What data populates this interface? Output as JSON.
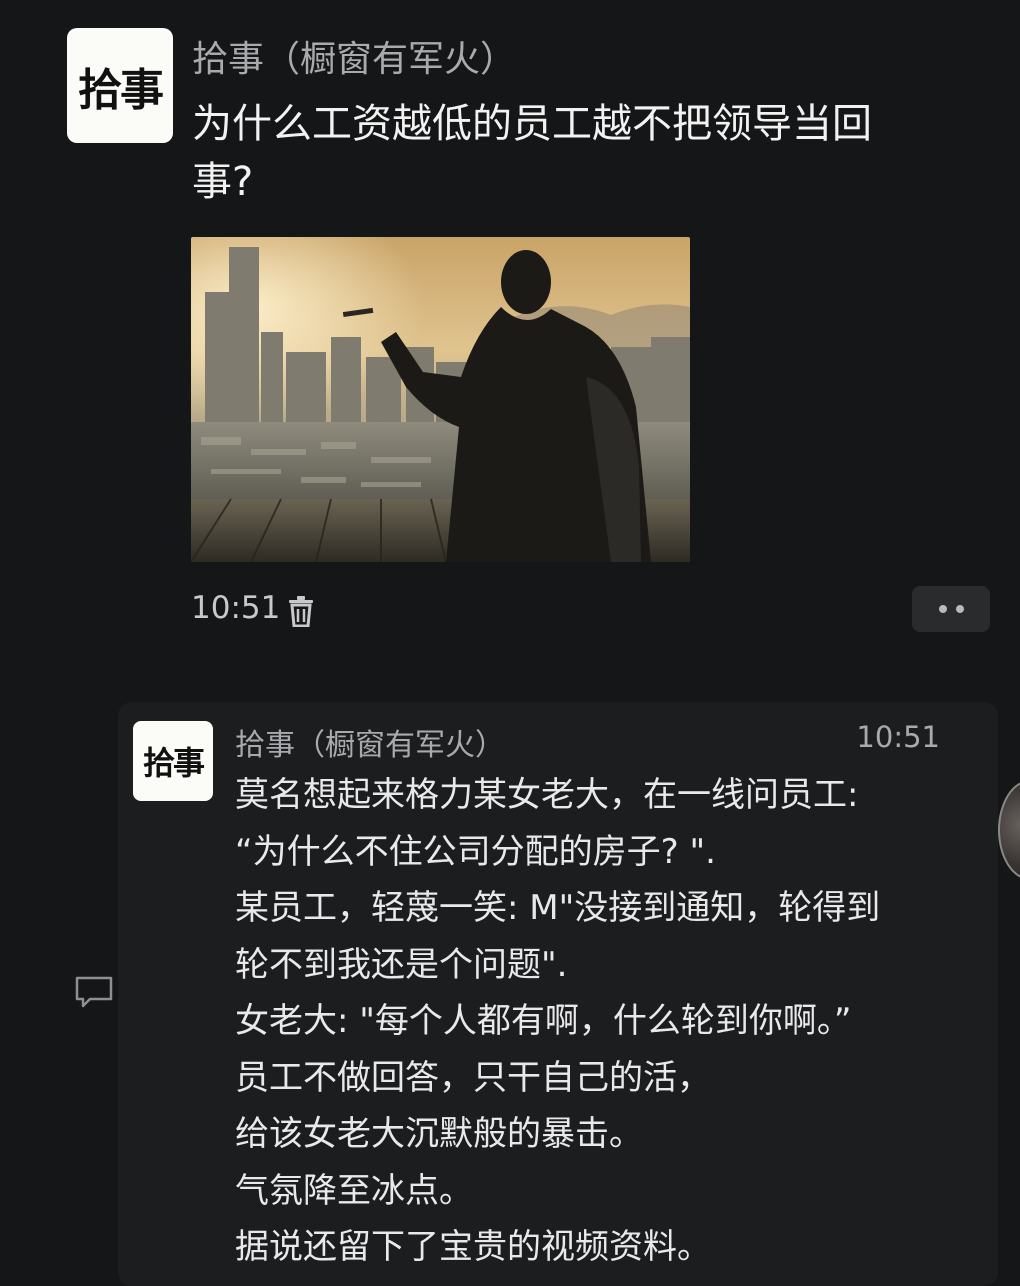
{
  "post": {
    "avatar_text": "拾事",
    "author": "拾事（橱窗有军火）",
    "title": "为什么工资越低的员工越不把领导当回事?",
    "time": "10:51"
  },
  "comment": {
    "avatar_text": "拾事",
    "author": "拾事（橱窗有军火）",
    "time": "10:51",
    "lines": [
      "莫名想起来格力某女老大，在一线问员工:",
      "“为什么不住公司分配的房子? \".",
      "某员工，轻蔑一笑: M\"没接到通知，轮得到",
      "轮不到我还是个问题\".",
      "女老大: \"每个人都有啊，什么轮到你啊。”",
      "员工不做回答，只干自己的活，",
      "给该女老大沉默般的暴击。",
      "气氛降至冰点。",
      "据说还留下了宝贵的视频资料。"
    ]
  },
  "icons": {
    "trash": "trash-icon",
    "comment": "comment-icon",
    "more": "more-dots-icon"
  },
  "colors": {
    "background": "#151617",
    "comment_card": "#1c1d1f",
    "text_primary": "#e9e9ea",
    "text_secondary": "#a9aaad"
  }
}
